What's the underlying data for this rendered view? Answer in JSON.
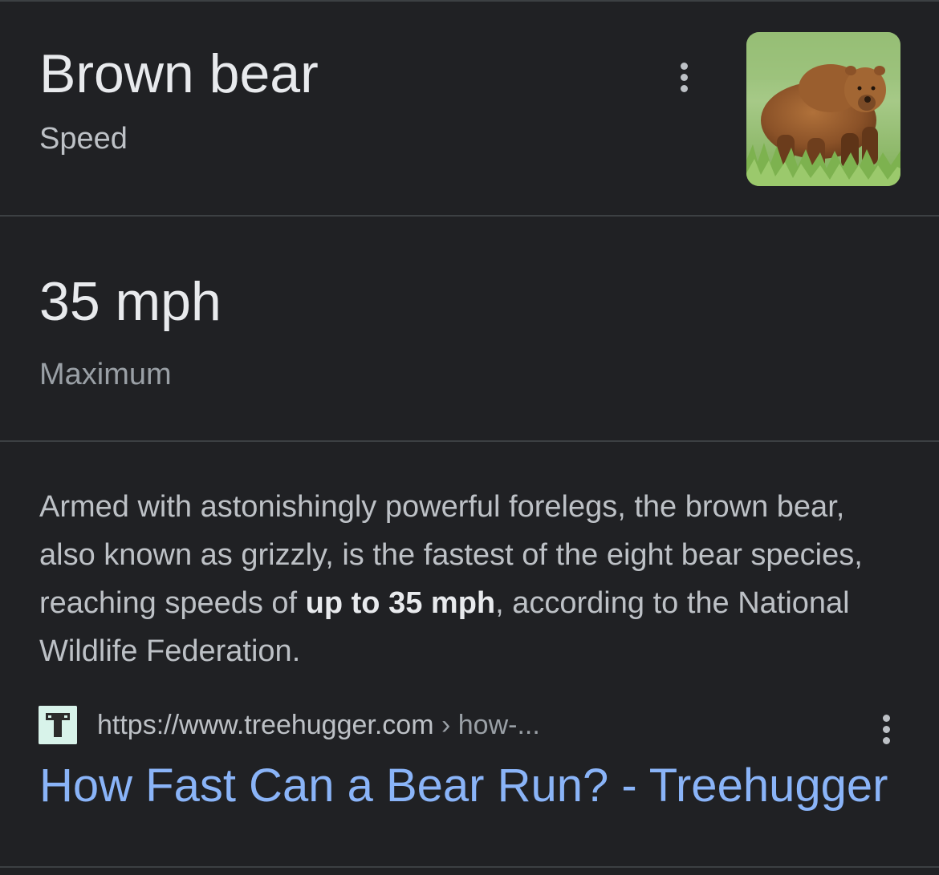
{
  "header": {
    "title": "Brown bear",
    "subtitle": "Speed",
    "menu_icon": "more-vert-icon",
    "image_alt": "brown bear photo"
  },
  "speed": {
    "value": "35 mph",
    "label": "Maximum"
  },
  "snippet": {
    "text_before": "Armed with astonishingly powerful forelegs, the brown bear, also known as grizzly, is the fastest of the eight bear species, reaching speeds of ",
    "highlight": "up to 35 mph",
    "text_after": ", according to the National Wildlife Federation."
  },
  "source": {
    "favicon_icon": "treehugger-favicon-icon",
    "url": "https://www.treehugger.com",
    "path": " › how-...",
    "menu_icon": "more-vert-icon",
    "title": "How Fast Can a Bear Run? - Treehugger"
  },
  "colors": {
    "background": "#202124",
    "divider": "#3c4043",
    "primary_text": "#e8eaed",
    "secondary_text": "#bdc1c6",
    "muted_text": "#9aa0a6",
    "link": "#8ab4f8"
  }
}
